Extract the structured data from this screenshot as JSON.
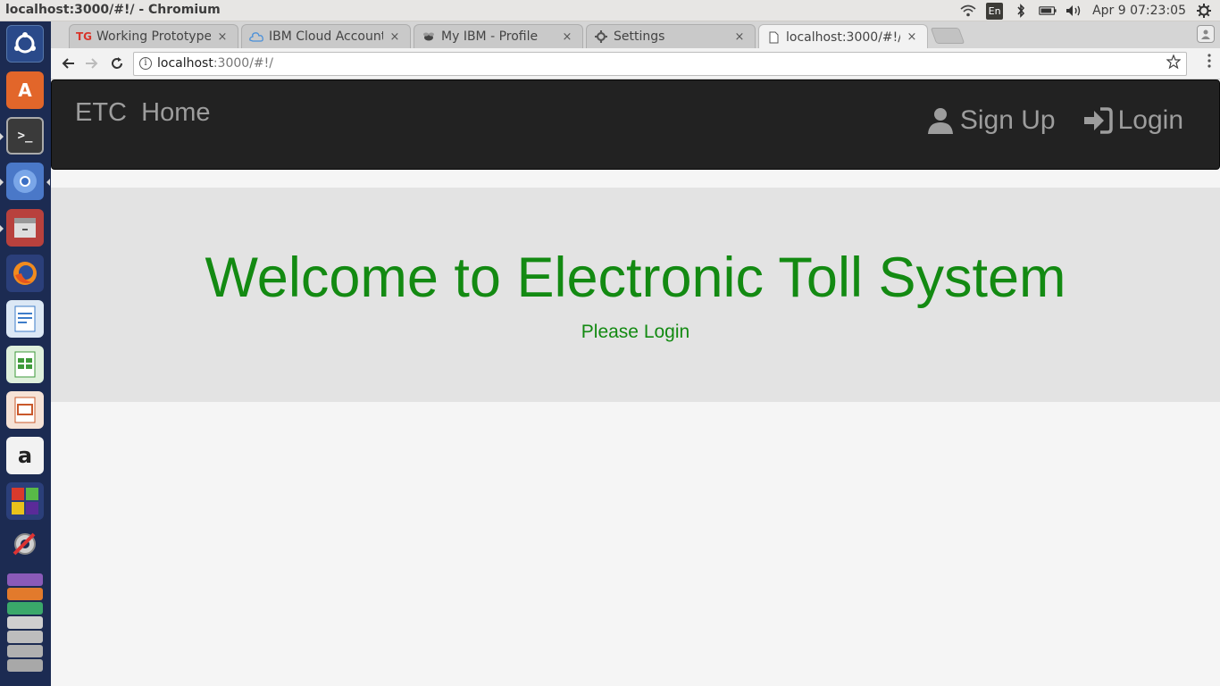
{
  "system": {
    "window_title": "localhost:3000/#!/ - Chromium",
    "lang_indicator": "En",
    "clock": "Apr  9 07:23:05",
    "tray_icons": [
      "wifi-icon",
      "bluetooth-icon",
      "battery-icon",
      "volume-icon",
      "gear-icon"
    ]
  },
  "launcher": {
    "items": [
      "ubuntu-dash",
      "software-center",
      "terminal",
      "chromium",
      "files",
      "firefox",
      "writer",
      "calc",
      "impress",
      "amazon",
      "unity-webapps",
      "system-settings",
      "app-stack"
    ]
  },
  "browser": {
    "tabs": [
      {
        "label": "Working Prototype",
        "favicon": "TG"
      },
      {
        "label": "IBM Cloud Account",
        "favicon": "cloud-icon"
      },
      {
        "label": "My IBM - Profile",
        "favicon": "bee-icon"
      },
      {
        "label": "Settings",
        "favicon": "gear-icon"
      },
      {
        "label": "localhost:3000/#!/",
        "favicon": "page-icon",
        "active": true
      }
    ],
    "close_glyph": "×",
    "url_host": "localhost",
    "url_rest": ":3000/#!/"
  },
  "page": {
    "brand_etc": "ETC",
    "brand_home": "Home",
    "nav": {
      "signup_label": "Sign Up",
      "login_label": "Login"
    },
    "hero": {
      "title": "Welcome to Electronic Toll System",
      "subtitle": "Please Login"
    },
    "colors": {
      "navbar_bg": "#222222",
      "nav_text": "#9d9d9d",
      "hero_bg": "#e3e3e3",
      "hero_text": "#138a12",
      "launcher_bg": "#1c2b52"
    }
  }
}
